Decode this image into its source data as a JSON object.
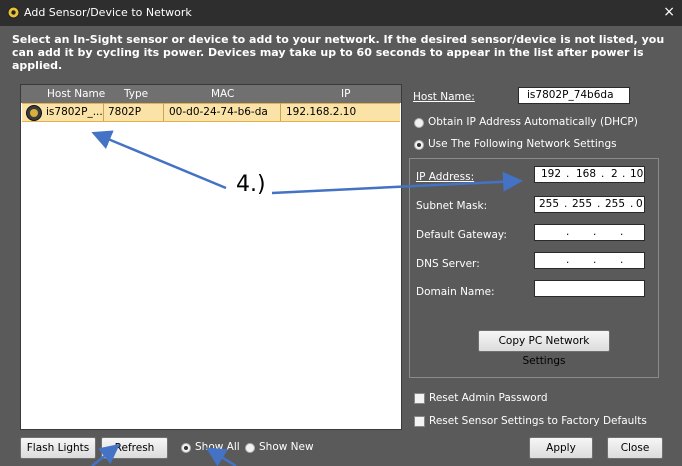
{
  "window": {
    "title": "Add Sensor/Device to Network",
    "close_glyph": "×",
    "icon": "sensor-app-icon"
  },
  "instructions": "Select an In-Sight sensor or device to add to your network.  If the desired sensor/device is not listed, you can add it by cycling its power.  Devices may take up to 60 seconds to appear in the list after power is applied.",
  "table": {
    "columns": [
      "Host Name",
      "Type",
      "MAC",
      "IP"
    ],
    "rows": [
      {
        "host": "is7802P_...",
        "type": "7802P",
        "mac": "00-d0-24-74-b6-da",
        "ip": "192.168.2.10"
      }
    ]
  },
  "settings": {
    "host_name_label": "Host Name:",
    "host_name_value": "is7802P_74b6da",
    "dhcp_label": "Obtain IP Address Automatically (DHCP)",
    "static_label": "Use The Following Network Settings",
    "ip_label": "IP Address:",
    "ip_value": [
      "192",
      "168",
      "2",
      "10"
    ],
    "subnet_label": "Subnet Mask:",
    "subnet_value": [
      "255",
      "255",
      "255",
      "0"
    ],
    "gateway_label": "Default Gateway:",
    "dns_label": "DNS Server:",
    "domain_label": "Domain Name:",
    "dot": ".",
    "copy_button": "Copy PC Network Settings",
    "reset_admin_label": "Reset Admin Password",
    "reset_factory_label": "Reset Sensor Settings to Factory Defaults"
  },
  "footer": {
    "flash_button": "Flash Lights",
    "refresh_button": "Refresh",
    "show_all_label": "Show All",
    "show_new_label": "Show New",
    "apply_button": "Apply",
    "close_button": "Close"
  },
  "annotation": {
    "text": "4.)",
    "arrow_color": "#4472c4"
  }
}
